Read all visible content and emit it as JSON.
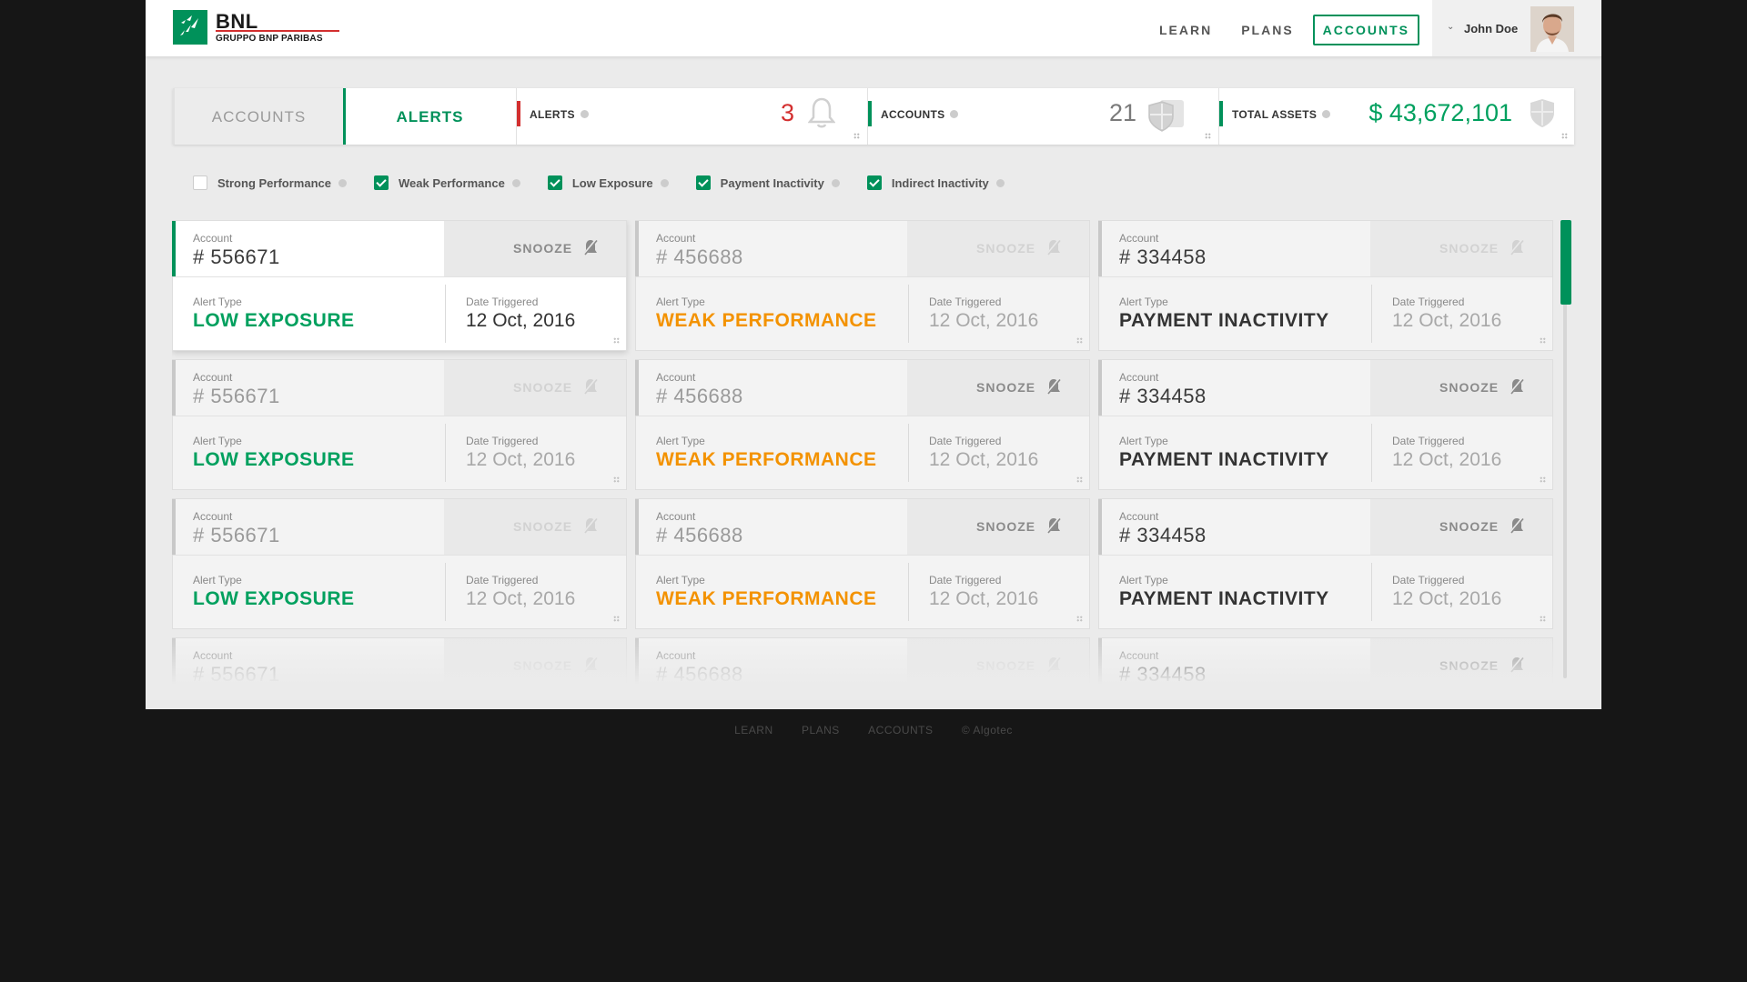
{
  "brand": {
    "name": "BNL",
    "sub": "GRUPPO BNP PARIBAS"
  },
  "nav": {
    "learn": "LEARN",
    "plans": "PLANS",
    "accounts": "ACCOUNTS"
  },
  "user": {
    "name": "John Doe"
  },
  "tabs": {
    "accounts": "ACCOUNTS",
    "alerts": "ALERTS"
  },
  "stats": {
    "alerts": {
      "label": "ALERTS",
      "value": "3"
    },
    "accounts": {
      "label": "ACCOUNTS",
      "value": "21"
    },
    "assets": {
      "label": "TOTAL ASSETS",
      "value": "$ 43,672,101"
    }
  },
  "filters": [
    {
      "label": "Strong Performance",
      "checked": false
    },
    {
      "label": "Weak Performance",
      "checked": true
    },
    {
      "label": "Low Exposure",
      "checked": true
    },
    {
      "label": "Payment Inactivity",
      "checked": true
    },
    {
      "label": "Indirect Inactivity",
      "checked": true
    }
  ],
  "labels": {
    "account": "Account",
    "alert_type": "Alert Type",
    "date_triggered": "Date Triggered",
    "snooze": "SNOOZE"
  },
  "columns": [
    {
      "account": "# 556671",
      "type": "LOW EXPOSURE",
      "date": "12 Oct, 2016"
    },
    {
      "account": "# 456688",
      "type": "WEAK PERFORMANCE",
      "date": "12 Oct, 2016"
    },
    {
      "account": "# 334458",
      "type": "PAYMENT INACTIVITY",
      "date": "12 Oct, 2016"
    }
  ],
  "footer": {
    "learn": "LEARN",
    "plans": "PLANS",
    "accounts": "ACCOUNTS",
    "copyright": "© Algotec"
  },
  "colors": {
    "brand_green": "#00915a",
    "alert_red": "#d32f2f",
    "low_exposure": "#00a05e",
    "weak_performance": "#f39200",
    "payment_inactivity": "#333333"
  }
}
